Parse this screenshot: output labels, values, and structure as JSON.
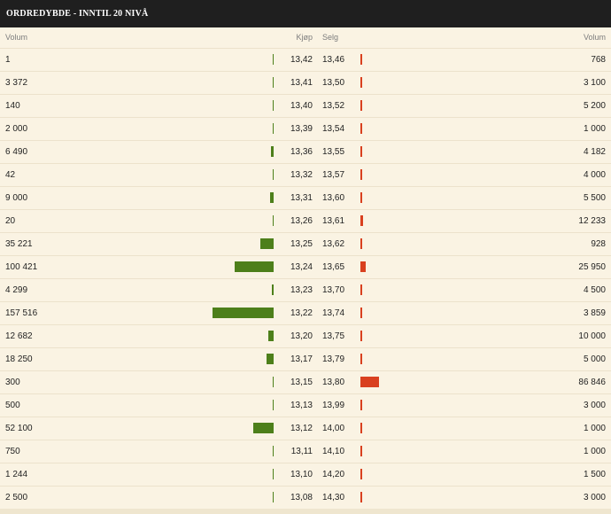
{
  "title": "ORDREDYBDE - INNTIL 20 NIVÅ",
  "columns": {
    "buy_volume": "Volum",
    "buy_price": "Kjøp",
    "sell_price": "Selg",
    "sell_volume": "Volum"
  },
  "colors": {
    "buy_bar": "#4d7f1a",
    "sell_bar": "#d9401f",
    "header_bg": "#1f1f1f",
    "panel_bg": "#faf3e3"
  },
  "rows": [
    {
      "buy_volume": "1",
      "buy_price": "13,42",
      "sell_price": "13,46",
      "sell_volume": "768"
    },
    {
      "buy_volume": "3 372",
      "buy_price": "13,41",
      "sell_price": "13,50",
      "sell_volume": "3 100"
    },
    {
      "buy_volume": "140",
      "buy_price": "13,40",
      "sell_price": "13,52",
      "sell_volume": "5 200"
    },
    {
      "buy_volume": "2 000",
      "buy_price": "13,39",
      "sell_price": "13,54",
      "sell_volume": "1 000"
    },
    {
      "buy_volume": "6 490",
      "buy_price": "13,36",
      "sell_price": "13,55",
      "sell_volume": "4 182"
    },
    {
      "buy_volume": "42",
      "buy_price": "13,32",
      "sell_price": "13,57",
      "sell_volume": "4 000"
    },
    {
      "buy_volume": "9 000",
      "buy_price": "13,31",
      "sell_price": "13,60",
      "sell_volume": "5 500"
    },
    {
      "buy_volume": "20",
      "buy_price": "13,26",
      "sell_price": "13,61",
      "sell_volume": "12 233"
    },
    {
      "buy_volume": "35 221",
      "buy_price": "13,25",
      "sell_price": "13,62",
      "sell_volume": "928"
    },
    {
      "buy_volume": "100 421",
      "buy_price": "13,24",
      "sell_price": "13,65",
      "sell_volume": "25 950"
    },
    {
      "buy_volume": "4 299",
      "buy_price": "13,23",
      "sell_price": "13,70",
      "sell_volume": "4 500"
    },
    {
      "buy_volume": "157 516",
      "buy_price": "13,22",
      "sell_price": "13,74",
      "sell_volume": "3 859"
    },
    {
      "buy_volume": "12 682",
      "buy_price": "13,20",
      "sell_price": "13,75",
      "sell_volume": "10 000"
    },
    {
      "buy_volume": "18 250",
      "buy_price": "13,17",
      "sell_price": "13,79",
      "sell_volume": "5 000"
    },
    {
      "buy_volume": "300",
      "buy_price": "13,15",
      "sell_price": "13,80",
      "sell_volume": "86 846"
    },
    {
      "buy_volume": "500",
      "buy_price": "13,13",
      "sell_price": "13,99",
      "sell_volume": "3 000"
    },
    {
      "buy_volume": "52 100",
      "buy_price": "13,12",
      "sell_price": "14,00",
      "sell_volume": "1 000"
    },
    {
      "buy_volume": "750",
      "buy_price": "13,11",
      "sell_price": "14,10",
      "sell_volume": "1 000"
    },
    {
      "buy_volume": "1 244",
      "buy_price": "13,10",
      "sell_price": "14,20",
      "sell_volume": "1 500"
    },
    {
      "buy_volume": "2 500",
      "buy_price": "13,08",
      "sell_price": "14,30",
      "sell_volume": "3 000"
    }
  ]
}
